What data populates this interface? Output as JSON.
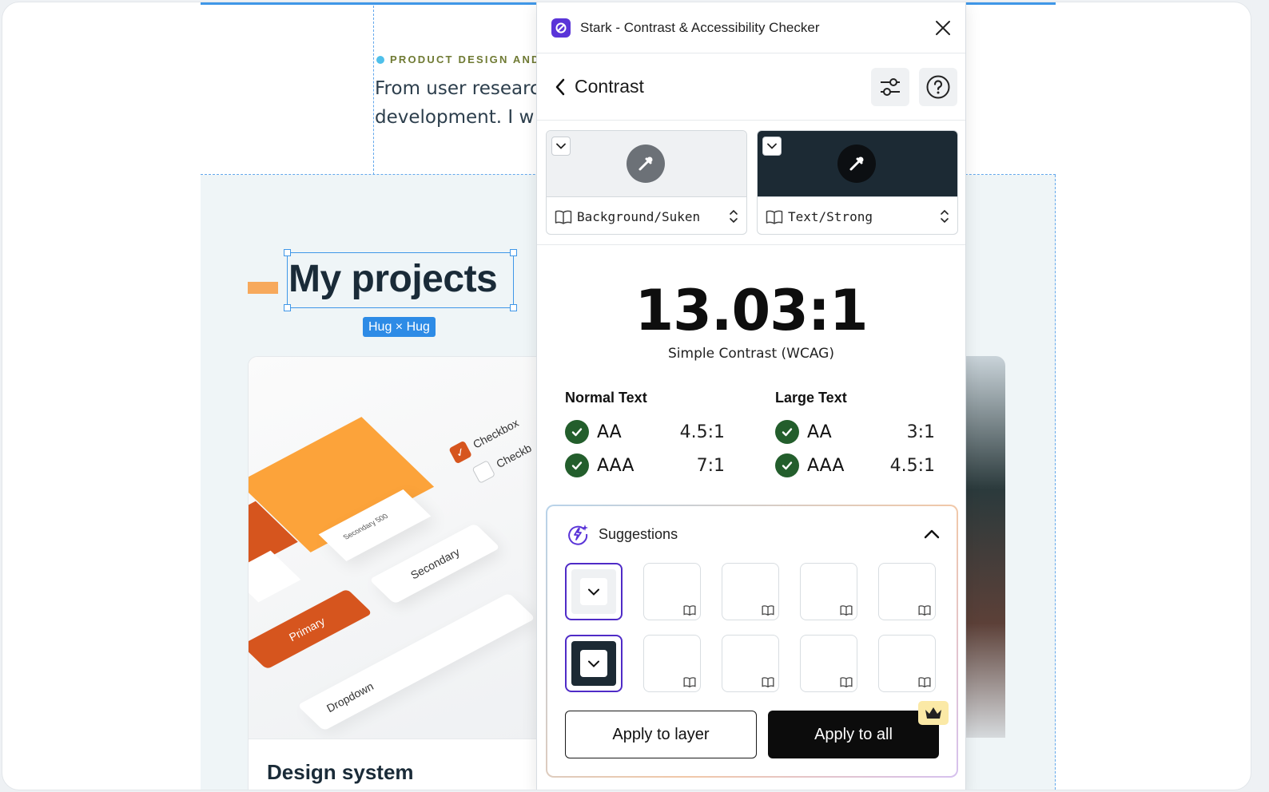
{
  "canvas": {
    "eyebrow": "PRODUCT DESIGN AND",
    "hero_line1": "From user researc",
    "hero_line2": "development. I w",
    "section_title": "My projects",
    "selection_badge": "Hug × Hug",
    "card": {
      "title": "Design system",
      "swatch_label": "Secondary 500",
      "secondary_button": "Secondary",
      "primary_button": "Primary",
      "dropdown_label": "Dropdown",
      "checkbox1": "Checkbox",
      "checkbox2": "Checkb"
    }
  },
  "plugin": {
    "title": "Stark - Contrast & Accessibility Checker",
    "page_title": "Contrast",
    "background_token": "Background/Suken",
    "foreground_token": "Text/Strong",
    "colors": {
      "background": "#eff1f3",
      "foreground": "#1c2a34",
      "pass": "#235e2c",
      "accent": "#4f2bc7"
    },
    "ratio": "13.03:1",
    "ratio_label": "Simple Contrast (WCAG)",
    "normal_text": {
      "heading": "Normal Text",
      "rows": [
        {
          "level": "AA",
          "threshold": "4.5:1",
          "status": "pass"
        },
        {
          "level": "AAA",
          "threshold": "7:1",
          "status": "pass"
        }
      ]
    },
    "large_text": {
      "heading": "Large Text",
      "rows": [
        {
          "level": "AA",
          "threshold": "3:1",
          "status": "pass"
        },
        {
          "level": "AAA",
          "threshold": "4.5:1",
          "status": "pass"
        }
      ]
    },
    "suggestions": {
      "title": "Suggestions",
      "apply_layer": "Apply to layer",
      "apply_all": "Apply to all"
    },
    "icons": [
      "stark-logo-icon",
      "close-icon",
      "chevron-left-icon",
      "settings-sliders-icon",
      "help-icon",
      "eyedropper-icon",
      "book-icon",
      "updown-icon",
      "lightning-sparkle-icon",
      "chevron-up-icon",
      "crown-icon"
    ]
  }
}
